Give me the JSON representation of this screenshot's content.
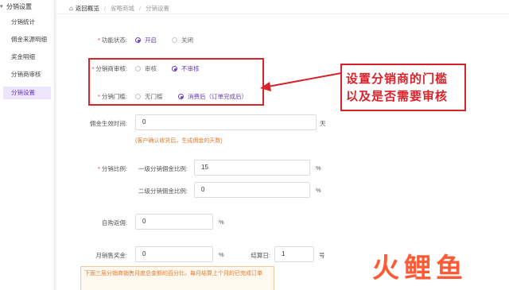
{
  "sidebar": {
    "section": "分销设置",
    "items": [
      {
        "label": "分销统计",
        "active": false
      },
      {
        "label": "佣金来源明细",
        "active": false
      },
      {
        "label": "奖金明细",
        "active": false
      },
      {
        "label": "分销商审核",
        "active": false
      },
      {
        "label": "分销设置",
        "active": true
      }
    ]
  },
  "breadcrumb": [
    "返回概览",
    "省略商城",
    "分销设置"
  ],
  "form": {
    "function_status": {
      "label": "功能状态:",
      "options": [
        "开启",
        "关闭"
      ],
      "selected": "开启"
    },
    "distributor_audit": {
      "label": "分销商审核:",
      "options": [
        "审核",
        "不审核"
      ],
      "selected": "不审核"
    },
    "distribution_threshold": {
      "label": "分销门槛:",
      "options": [
        "无门槛",
        "消费后（订单完成后）"
      ],
      "selected": "消费后（订单完成后）"
    },
    "commission_effective_time": {
      "label": "佣金生效时间:",
      "value": "0",
      "unit": "天",
      "hint": "(客户确认收货后，生成佣金的天数)"
    },
    "distribution_ratio": {
      "label": "分销比例:",
      "level1_label": "一级分销佣金比例:",
      "level1_value": "15",
      "level1_unit": "%",
      "level2_label": "二级分销佣金比例:",
      "level2_value": "0",
      "level2_unit": "%"
    },
    "self_purchase_rebate": {
      "label": "自购返佣:",
      "value": "0",
      "unit": "%"
    },
    "monthly_sales_bonus": {
      "label": "月销售奖金:",
      "value": "0",
      "unit": "%",
      "settle_label": "结算日:",
      "settle_value": "1",
      "settle_unit": "号"
    },
    "notice": "下面三层分销商销售月度总金额的百分比，每月结算上个月的已完成订单"
  },
  "annotation": {
    "lines": [
      "设置分销商的门槛",
      "以及是否需要审核"
    ],
    "color": "#d9232b"
  },
  "watermark": {
    "text": "火鲤鱼"
  },
  "colors": {
    "accent": "#6a3cc4",
    "hint": "#e07a2e",
    "required": "#e33333"
  }
}
